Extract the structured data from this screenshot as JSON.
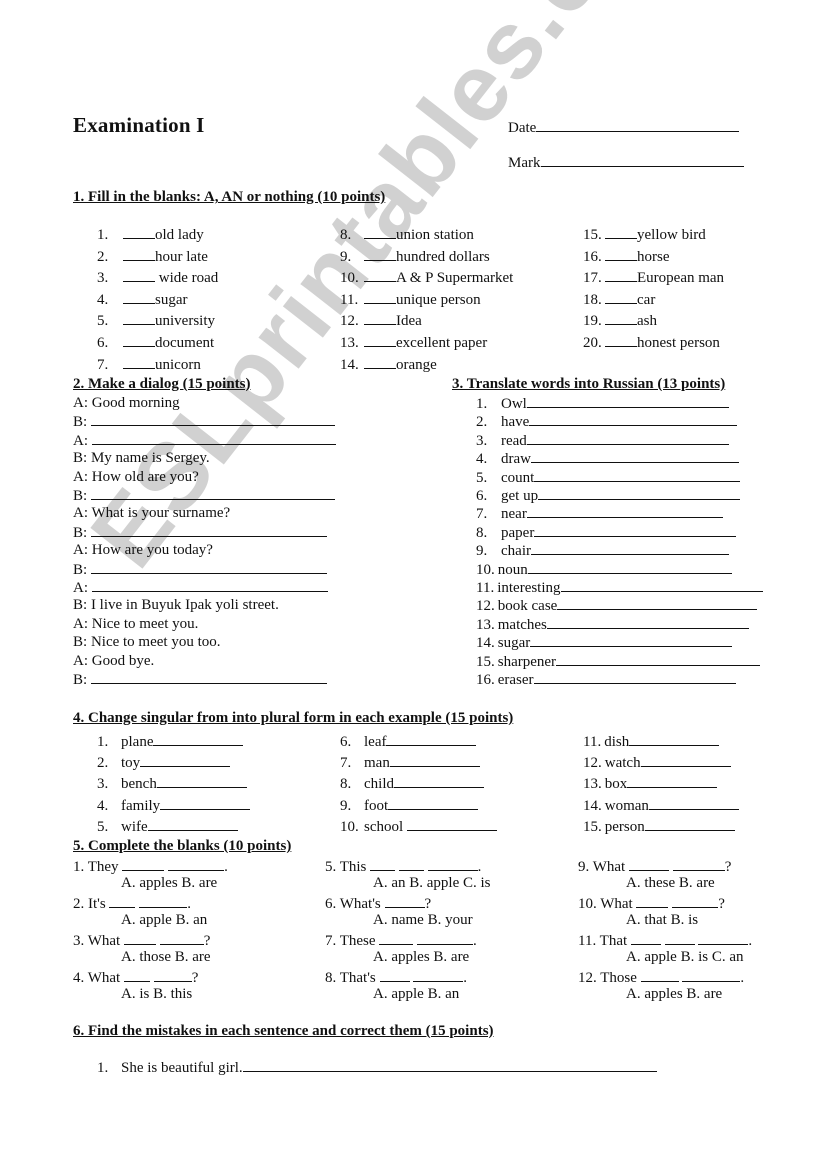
{
  "header": {
    "title": "Examination I",
    "date_label": "Date",
    "mark_label": "Mark"
  },
  "watermark": "ESLprintables.com",
  "section1": {
    "heading": "1. Fill in the blanks: A, AN or nothing (10 points)",
    "items": [
      {
        "n": "1.",
        "text": "old lady"
      },
      {
        "n": "2.",
        "text": "hour late"
      },
      {
        "n": "3.",
        "text": " wide road"
      },
      {
        "n": "4.",
        "text": "sugar"
      },
      {
        "n": "5.",
        "text": "university"
      },
      {
        "n": "6.",
        "text": "document"
      },
      {
        "n": "7.",
        "text": "unicorn"
      },
      {
        "n": "8.",
        "text": "union station"
      },
      {
        "n": "9.",
        "text": "hundred dollars"
      },
      {
        "n": "10.",
        "text": "A & P Supermarket"
      },
      {
        "n": "11.",
        "text": "unique person"
      },
      {
        "n": "12.",
        "text": "Idea"
      },
      {
        "n": "13.",
        "text": "excellent paper"
      },
      {
        "n": "14.",
        "text": "orange"
      },
      {
        "n": "15.",
        "text": "yellow bird"
      },
      {
        "n": "16.",
        "text": "horse"
      },
      {
        "n": "17.",
        "text": "European man"
      },
      {
        "n": "18.",
        "text": "car"
      },
      {
        "n": "19.",
        "text": "ash"
      },
      {
        "n": "20.",
        "text": "honest person"
      }
    ]
  },
  "section2": {
    "heading": "2. Make a dialog (15 points)",
    "lines": [
      {
        "speaker": "A:",
        "text": " Good morning",
        "blank": false
      },
      {
        "speaker": "B:",
        "text": "",
        "blank": true
      },
      {
        "speaker": "A:",
        "text": "",
        "blank": true
      },
      {
        "speaker": "B:",
        "text": "My name is Sergey.",
        "blank": false
      },
      {
        "speaker": "A:",
        "text": "How old are you?",
        "blank": false
      },
      {
        "speaker": "B:",
        "text": "",
        "blank": true
      },
      {
        "speaker": "A:",
        "text": "What is your surname?",
        "blank": false
      },
      {
        "speaker": "B:",
        "text": "",
        "blank": true
      },
      {
        "speaker": "A:",
        "text": "How are you today?",
        "blank": false
      },
      {
        "speaker": "B:",
        "text": "",
        "blank": true
      },
      {
        "speaker": "A:",
        "text": "",
        "blank": true
      },
      {
        "speaker": "B:",
        "text": "I live in Buyuk Ipak yoli street.",
        "blank": false
      },
      {
        "speaker": "A:",
        "text": "Nice to meet you.",
        "blank": false
      },
      {
        "speaker": "B:",
        "text": "Nice to meet you too.",
        "blank": false
      },
      {
        "speaker": "A:",
        "text": "Good bye.",
        "blank": false
      },
      {
        "speaker": "B:",
        "text": "",
        "blank": true
      }
    ]
  },
  "section3": {
    "heading": "3. Translate words into Russian (13 points)",
    "items": [
      {
        "n": "1.",
        "word": "Owl"
      },
      {
        "n": "2.",
        "word": "have"
      },
      {
        "n": "3.",
        "word": "read"
      },
      {
        "n": "4.",
        "word": "draw"
      },
      {
        "n": "5.",
        "word": "count"
      },
      {
        "n": "6.",
        "word": "get up"
      },
      {
        "n": "7.",
        "word": "near"
      },
      {
        "n": "8.",
        "word": "paper"
      },
      {
        "n": "9.",
        "word": "chair"
      },
      {
        "n": "10.",
        "word": "noun"
      },
      {
        "n": "11.",
        "word": "interesting"
      },
      {
        "n": "12.",
        "word": "book case"
      },
      {
        "n": "13.",
        "word": "matches"
      },
      {
        "n": "14.",
        "word": "sugar"
      },
      {
        "n": "15.",
        "word": "sharpener"
      },
      {
        "n": "16.",
        "word": "eraser"
      }
    ]
  },
  "section4": {
    "heading": "4. Change singular from into plural form in each example (15 points)",
    "items": [
      {
        "n": "1.",
        "word": "plane"
      },
      {
        "n": "2.",
        "word": "toy"
      },
      {
        "n": "3.",
        "word": "bench"
      },
      {
        "n": "4.",
        "word": "family"
      },
      {
        "n": "5.",
        "word": "wife"
      },
      {
        "n": "6.",
        "word": "leaf"
      },
      {
        "n": "7.",
        "word": "man"
      },
      {
        "n": "8.",
        "word": "child"
      },
      {
        "n": "9.",
        "word": "foot"
      },
      {
        "n": "10.",
        "word": "school "
      },
      {
        "n": "11.",
        "word": "dish"
      },
      {
        "n": "12.",
        "word": "watch"
      },
      {
        "n": "13.",
        "word": "box"
      },
      {
        "n": "14.",
        "word": "woman"
      },
      {
        "n": "15.",
        "word": "person"
      }
    ]
  },
  "section5": {
    "heading": "5. Complete the blanks (10 points)",
    "items": [
      {
        "prompt": "1. They",
        "end": ".",
        "options": "A. apples B. are"
      },
      {
        "prompt": "2. It's",
        "end": ".",
        "options": "A. apple B. an"
      },
      {
        "prompt": "3. What",
        "end": "?",
        "options": "A. those B. are"
      },
      {
        "prompt": "4. What",
        "end": "?",
        "options": "A. is B. this"
      },
      {
        "prompt": "5. This",
        "end": ".",
        "options": "A. an B. apple C. is"
      },
      {
        "prompt": "6. What's",
        "end": "?",
        "options": "A. name B. your"
      },
      {
        "prompt": "7. These",
        "end": ".",
        "options": "A. apples B. are"
      },
      {
        "prompt": "8. That's",
        "end": ".",
        "options": "A. apple B. an"
      },
      {
        "prompt": "9. What",
        "end": "?",
        "options": "A. these B. are"
      },
      {
        "prompt": "10. What",
        "end": "?",
        "options": "A. that B. is"
      },
      {
        "prompt": "11. That",
        "end": ".",
        "options": "A. apple B. is C. an"
      },
      {
        "prompt": "12. Those",
        "end": ".",
        "options": "A. apples B. are"
      }
    ]
  },
  "section6": {
    "heading": "6. Find the mistakes in each sentence and correct them (15 points)",
    "items": [
      {
        "n": "1.",
        "sentence": "She is beautiful girl."
      }
    ]
  }
}
